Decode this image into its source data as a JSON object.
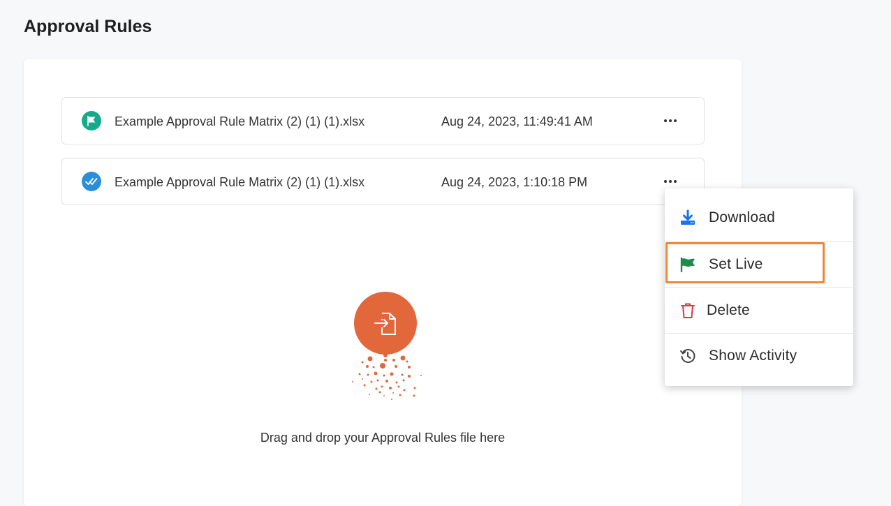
{
  "page": {
    "title": "Approval Rules"
  },
  "files": [
    {
      "name": "Example Approval Rule Matrix (2) (1) (1).xlsx",
      "date": "Aug 24, 2023, 11:49:41 AM",
      "status": "live"
    },
    {
      "name": "Example Approval Rule Matrix (2) (1) (1).xlsx",
      "date": "Aug 24, 2023, 1:10:18 PM",
      "status": "approved"
    }
  ],
  "upload": {
    "text": "Drag and drop your Approval Rules file here",
    "accent": "#e2673a"
  },
  "menu": {
    "items": [
      {
        "label": "Download",
        "icon": "download-icon"
      },
      {
        "label": "Set Live",
        "icon": "flag-icon"
      },
      {
        "label": "Delete",
        "icon": "trash-icon"
      },
      {
        "label": "Show Activity",
        "icon": "history-icon"
      }
    ],
    "highlighted": "Set Live"
  },
  "colors": {
    "live": "#16a98a",
    "approved": "#2a8fd8",
    "highlight": "#f08538",
    "download": "#1a73e8",
    "flag": "#1f8a4c",
    "delete": "#d93848"
  }
}
